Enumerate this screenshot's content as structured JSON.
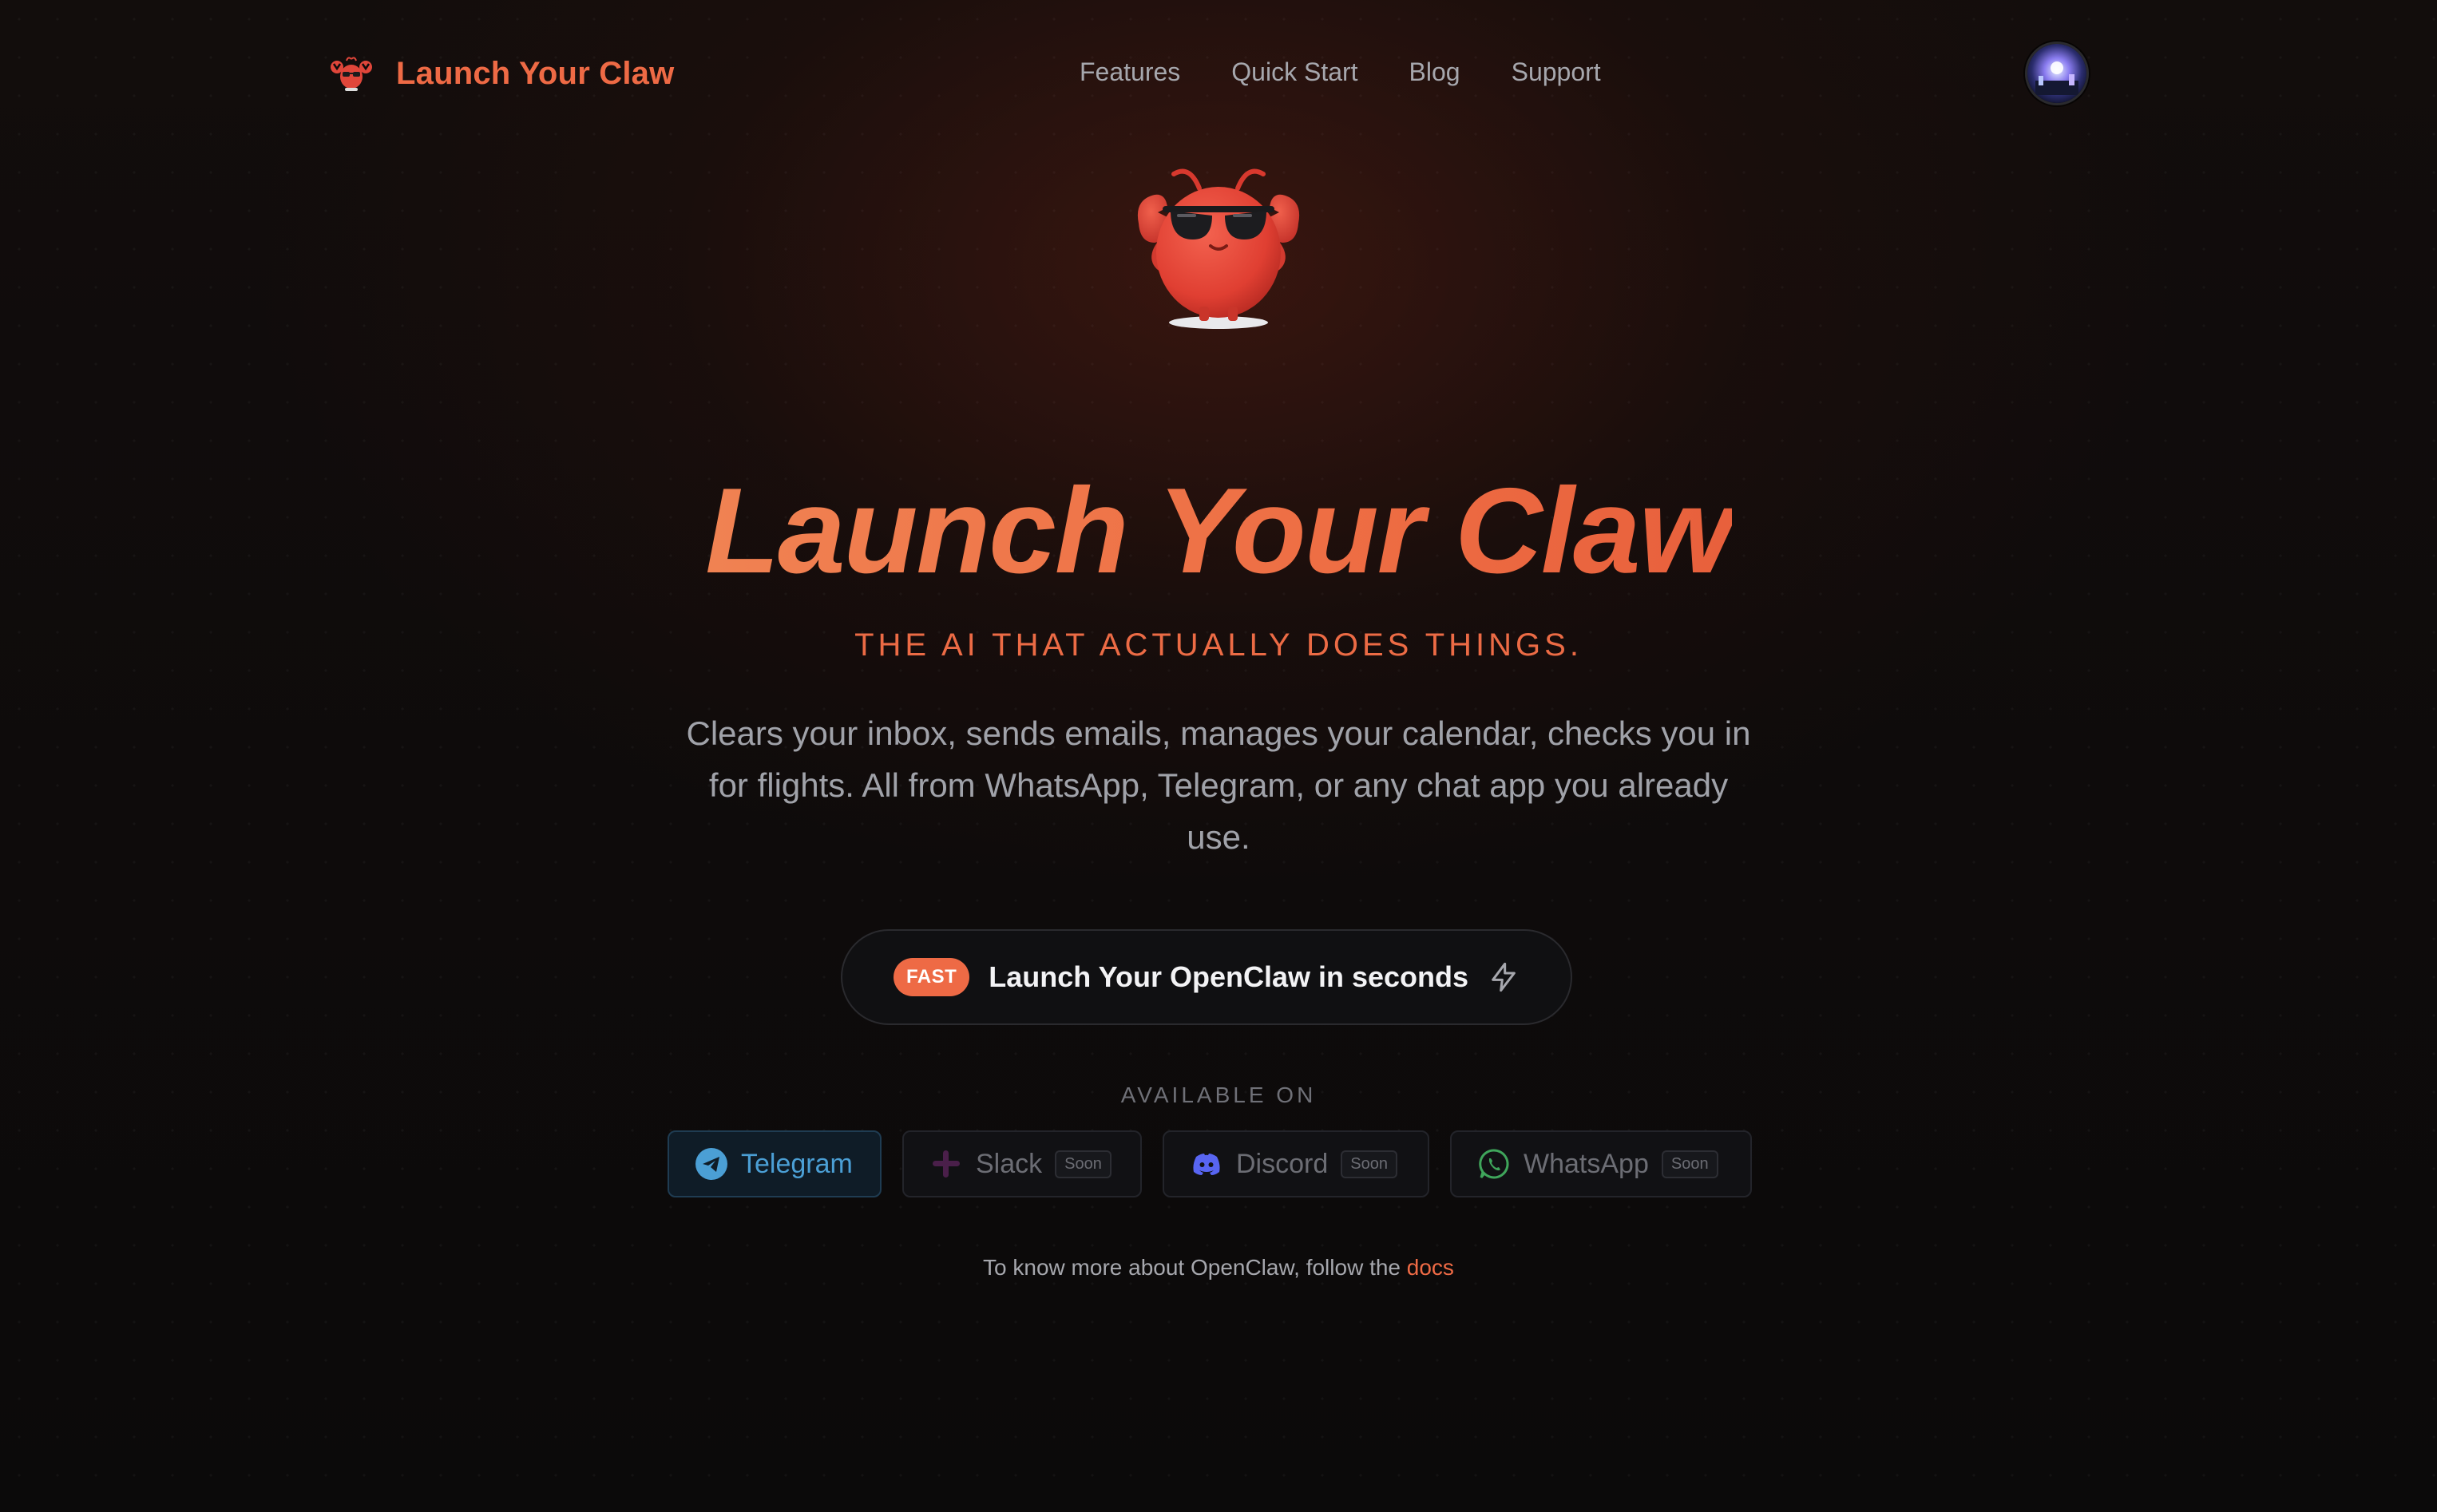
{
  "nav": {
    "brand": "Launch Your Claw",
    "links": [
      "Features",
      "Quick Start",
      "Blog",
      "Support"
    ]
  },
  "hero": {
    "title": "Launch Your Claw",
    "tagline": "THE AI THAT ACTUALLY DOES THINGS.",
    "description": "Clears your inbox, sends emails, manages your calendar, checks you in for flights. All from WhatsApp, Telegram, or any chat app you already use."
  },
  "cta": {
    "badge": "FAST",
    "label": "Launch Your OpenClaw in seconds",
    "icon": "lightning-icon"
  },
  "platforms": {
    "heading": "AVAILABLE ON",
    "items": [
      {
        "name": "Telegram",
        "icon": "telegram-icon",
        "badge": ""
      },
      {
        "name": "Slack",
        "icon": "slack-icon",
        "badge": "Soon"
      },
      {
        "name": "Discord",
        "icon": "discord-icon",
        "badge": "Soon"
      },
      {
        "name": "WhatsApp",
        "icon": "whatsapp-icon",
        "badge": "Soon"
      }
    ]
  },
  "footer": {
    "text": "To know more about OpenClaw, follow the",
    "link": "docs"
  },
  "colors": {
    "accent": "#ee6a45",
    "background": "#0b0a0a",
    "telegram": "#4b9fd5",
    "discord": "#5865f2",
    "whatsapp": "#3fa55b"
  }
}
